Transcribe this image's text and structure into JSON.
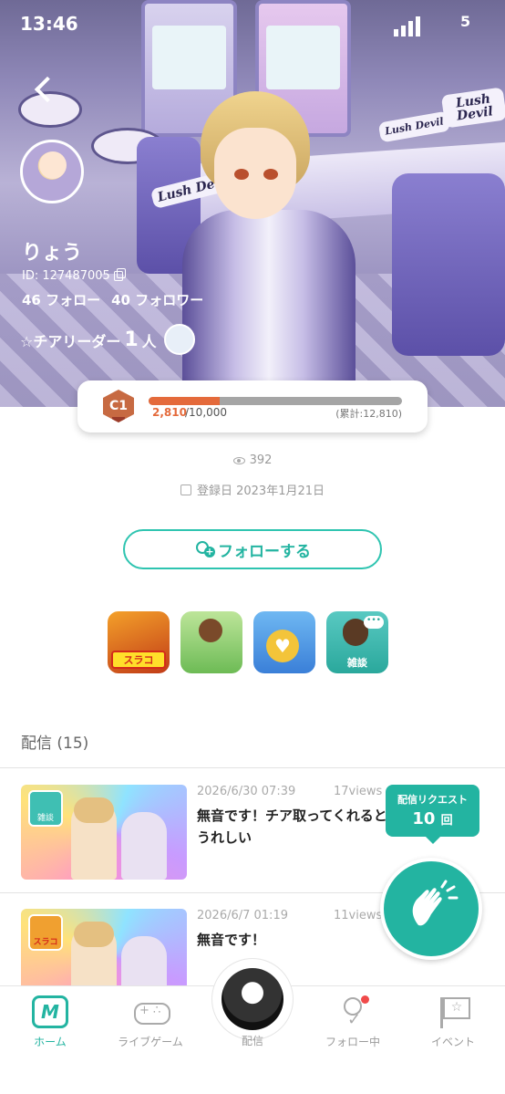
{
  "status_bar": {
    "time": "13:46",
    "battery": "5"
  },
  "hero": {
    "sign_text": "Lush Devil",
    "username": "りょう",
    "id_label": "ID: 127487005",
    "follow_count": "46 フォロー",
    "follower_count": "40 フォロワー",
    "cheer_label": "☆チアリーダー",
    "cheer_count": "1",
    "cheer_unit": "人"
  },
  "level": {
    "badge": "C1",
    "current": "2,810",
    "max": "/10,000",
    "total": "(累計:12,810)",
    "progress_fraction": 0.281
  },
  "stats": {
    "views": "392",
    "registered": "登録日 2023年1月21日"
  },
  "follow_button": {
    "label": "フォローする"
  },
  "games": [
    {
      "name": "slash-game-icon",
      "label": "スラコ"
    },
    {
      "name": "soccer-game-icon",
      "label": ""
    },
    {
      "name": "cat-coin-game-icon",
      "label": ""
    },
    {
      "name": "chat-game-icon",
      "label": "雑談"
    }
  ],
  "section": {
    "title": "配信 (15)"
  },
  "streams": [
    {
      "date": "2026/6/30 07:39",
      "views": "17views",
      "title": "無音です！チア取ってくれると うれしい",
      "tag": "雑談"
    },
    {
      "date": "2026/6/7 01:19",
      "views": "11views",
      "title": "無音です！",
      "tag": "スラコ"
    }
  ],
  "request": {
    "label": "配信リクエスト",
    "count": "10",
    "unit": "回"
  },
  "nav": {
    "home": "ホーム",
    "live_game": "ライブゲーム",
    "broadcast": "配信",
    "following": "フォロー中",
    "event": "イベント"
  },
  "colors": {
    "accent": "#23b4a1",
    "level_fill": "#e46a3b"
  }
}
